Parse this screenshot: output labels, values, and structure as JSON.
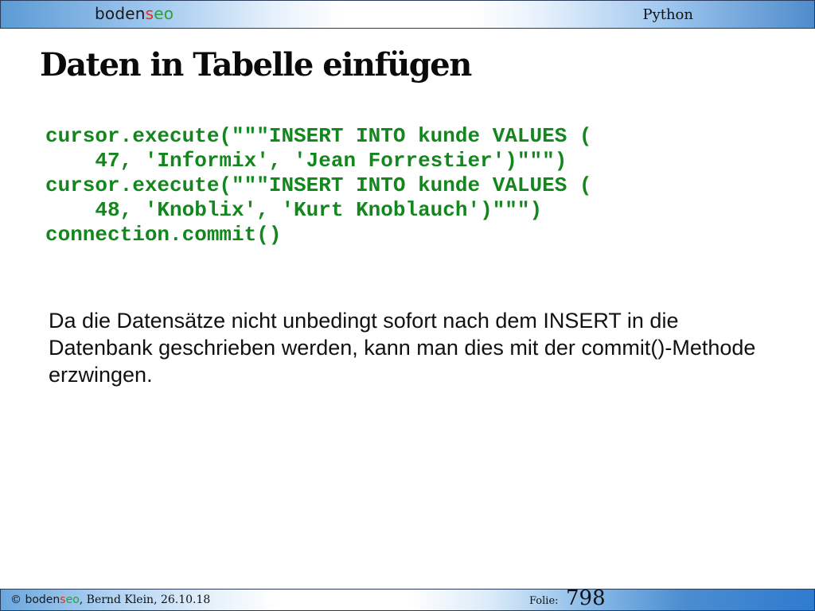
{
  "header": {
    "logo": {
      "part1": "boden",
      "part2": "s",
      "part3": "eo"
    },
    "topic": "Python"
  },
  "slide": {
    "title": "Daten in Tabelle einfügen",
    "code_lines": [
      "cursor.execute(\"\"\"INSERT INTO kunde VALUES (",
      "    47, 'Informix', 'Jean Forrestier')\"\"\")",
      "cursor.execute(\"\"\"INSERT INTO kunde VALUES (",
      "    48, 'Knoblix', 'Kurt Knoblauch')\"\"\")",
      "connection.commit()"
    ],
    "body": "Da die Datensätze nicht unbedingt sofort nach dem INSERT in die Datenbank geschrieben werden, kann man dies mit der commit()-Methode erzwingen."
  },
  "footer": {
    "copyright": "©",
    "logo": {
      "part1": "boden",
      "part2": "s",
      "part3": "eo"
    },
    "author_date": ", Bernd Klein, 26.10.18",
    "folie_label": "Folie:",
    "folie_number": "798"
  },
  "colors": {
    "code": "#14861e",
    "logo_red": "#e0301e",
    "logo_green": "#2e9e3a",
    "bar_blue": "#4f8ccc"
  }
}
